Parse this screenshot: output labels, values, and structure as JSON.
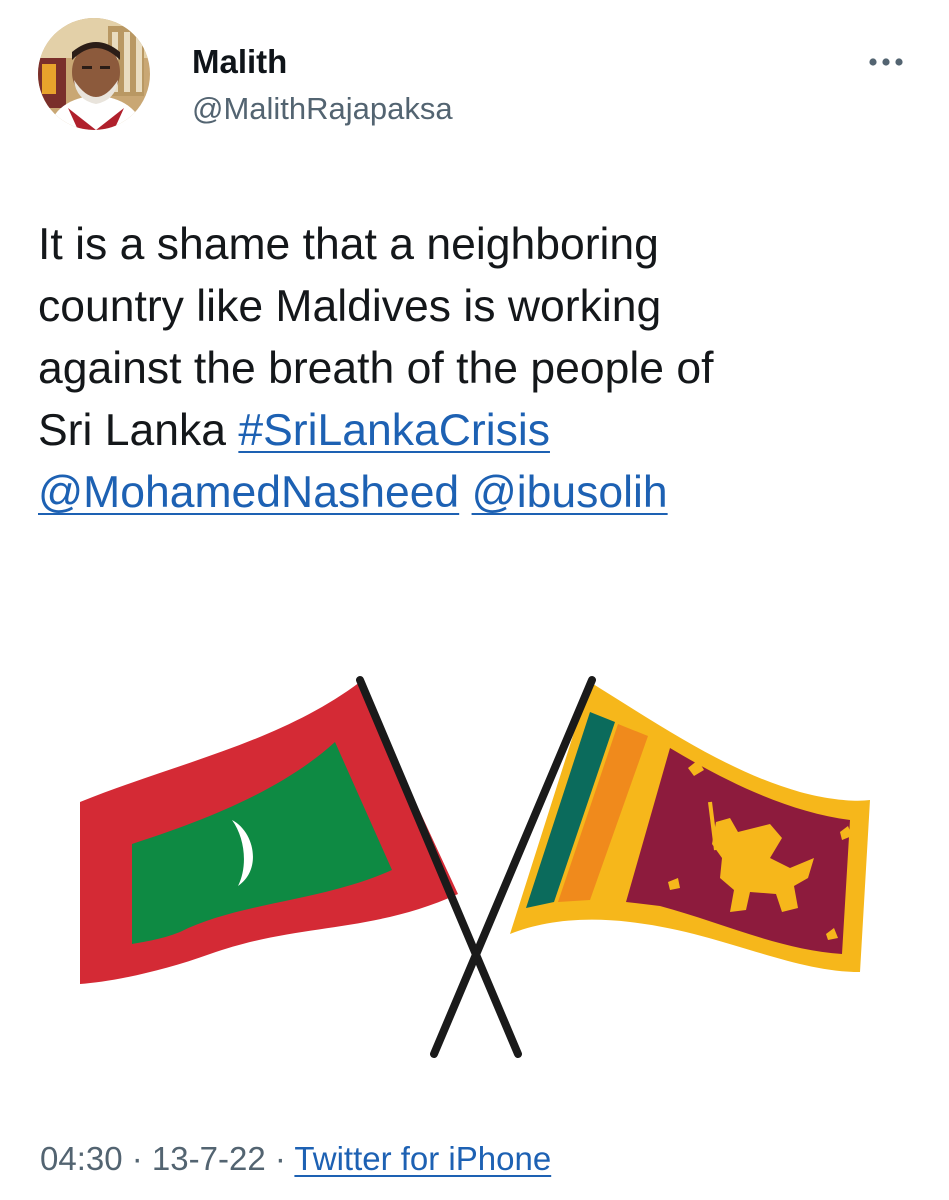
{
  "author": {
    "display_name": "Malith",
    "handle": "@MalithRajapaksa"
  },
  "tweet": {
    "lines": [
      "It is a shame that a neighboring",
      "country like Maldives is working",
      "against the breath of the people of",
      "Sri Lanka "
    ],
    "hashtag": "#SriLankaCrisis",
    "mentions": [
      "@MohamedNasheed",
      "@ibusolih"
    ]
  },
  "media": {
    "description_icons": [
      "maldives-flag",
      "sri-lanka-flag"
    ]
  },
  "meta": {
    "time": "04:30",
    "separator": " · ",
    "date": "13-7-22",
    "source": "Twitter for iPhone"
  },
  "icons": {
    "more": "more-horizontal-icon"
  },
  "colors": {
    "link": "#1d61b3",
    "secondary_text": "#536471",
    "maldives_red": "#d42a35",
    "maldives_green": "#0e8a43",
    "sri_lanka_yellow": "#f6b71b",
    "sri_lanka_maroon": "#8d1b3d",
    "sri_lanka_teal": "#0b6b5c",
    "sri_lanka_orange": "#f08a1c"
  }
}
